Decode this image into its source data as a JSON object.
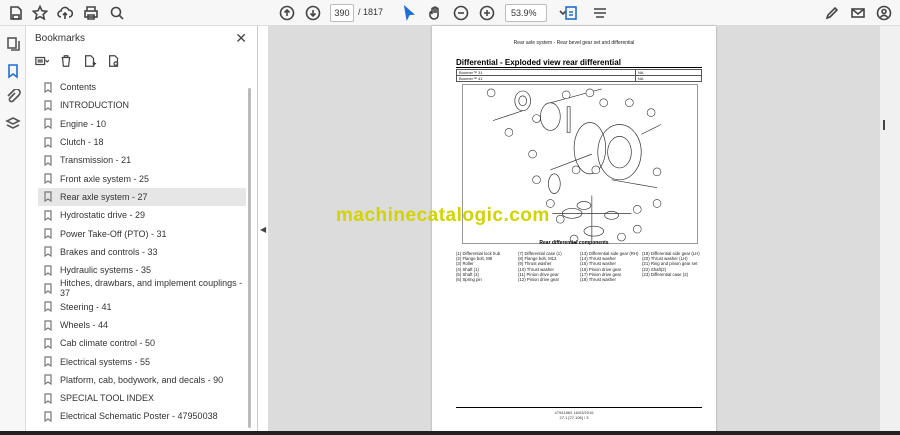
{
  "toolbar": {
    "page_current": "390",
    "page_total": "/  1817",
    "zoom": "53.9%"
  },
  "sidebar": {
    "title": "Bookmarks",
    "close_glyph": "✕",
    "items": [
      {
        "label": "Contents"
      },
      {
        "label": "INTRODUCTION"
      },
      {
        "label": "Engine - 10"
      },
      {
        "label": "Clutch - 18"
      },
      {
        "label": "Transmission - 21"
      },
      {
        "label": "Front axle system - 25"
      },
      {
        "label": "Rear axle system - 27"
      },
      {
        "label": "Hydrostatic drive - 29"
      },
      {
        "label": "Power Take-Off (PTO) - 31"
      },
      {
        "label": "Brakes and controls - 33"
      },
      {
        "label": "Hydraulic systems - 35"
      },
      {
        "label": "Hitches, drawbars, and implement couplings - 37"
      },
      {
        "label": "Steering - 41"
      },
      {
        "label": "Wheels - 44"
      },
      {
        "label": "Cab climate control - 50"
      },
      {
        "label": "Electrical systems - 55"
      },
      {
        "label": "Platform, cab, bodywork, and decals - 90"
      },
      {
        "label": "SPECIAL TOOL INDEX"
      },
      {
        "label": "Electrical Schematic Poster - 47950038"
      }
    ],
    "selected_index": 6
  },
  "document": {
    "header": "Rear axle system - Rear bevel gear set and differential",
    "title": "Differential - Exploded view rear differential",
    "table_rows": [
      [
        "Boomer™ 31",
        "NA"
      ],
      [
        "Boomer™ 41",
        "NA"
      ]
    ],
    "figure_caption": "Rear differential components",
    "watermark": "machinecatalogic.com",
    "parts": [
      "(1) Differential lock hub",
      "(7) Differential case (1)",
      "(13) Differential side gear (RH)",
      "(19) Differential side gear (LH)",
      "(2) Flange bolt, M8",
      "(8) Flange bolt, M12",
      "(14) Thrust washer",
      "(20) Thrust washer (LH)",
      "(3) Roller",
      "(9) Thrust washer",
      "(15) Thrust washer",
      "(21) Ring and pinion gear set",
      "(4) Shaft (1)",
      "(10) Thrust washer",
      "(16) Pinion drive gear",
      "(22) Shaft(2)",
      "(5) Shaft (2)",
      "(11) Pinion drive gear",
      "(17) Pinion drive gear",
      "(23) Differential case (2)",
      "(6) Spring pin",
      "(12) Pinion drive gear",
      "(18) Thrust washer",
      ""
    ],
    "footer_line1": "47941862 16/03/2016",
    "footer_line2": "27.1 [27.106] / 3"
  }
}
